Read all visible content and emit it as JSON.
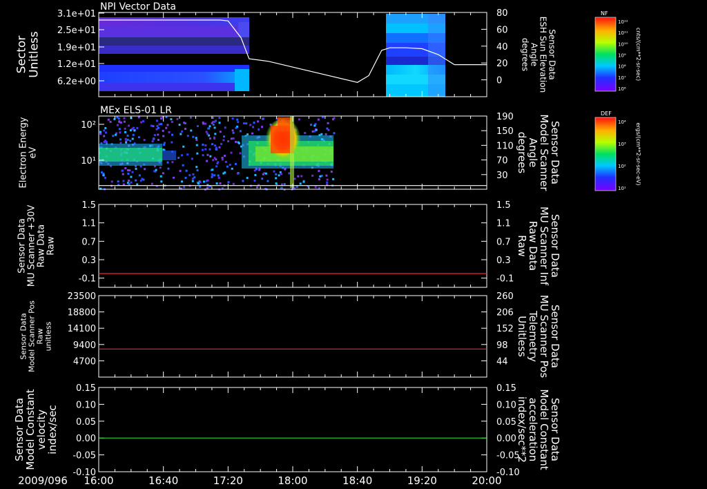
{
  "date_label": "2009/096",
  "time_ticks": [
    "16:00",
    "16:40",
    "17:20",
    "18:00",
    "18:40",
    "19:20",
    "20:00"
  ],
  "colorbars": [
    {
      "title": "NF",
      "unit": "cnts/(cm**2-sr-sec)",
      "tick_labels": [
        "10¹²",
        "10¹¹",
        "10¹⁰",
        "10⁹",
        "10⁸",
        "10⁷",
        "10⁶"
      ]
    },
    {
      "title": "DEF",
      "unit": "ergs/(cm**2-sr-sec-eV)",
      "tick_labels": [
        "10⁴",
        "10³",
        "10²",
        "10¹"
      ]
    }
  ],
  "colors": {
    "background": "#000000",
    "frame": "#ffffff",
    "red_trace": "#ff2020",
    "green_trace": "#22dd22"
  },
  "chart_data": [
    {
      "type": "heatmap",
      "title": "NPI Vector Data",
      "ylabel": [
        "Sector",
        "Unitless"
      ],
      "yticks": [
        "3.1e+01",
        "2.5e+01",
        "1.9e+01",
        "1.2e+01",
        "6.2e+00"
      ],
      "data_present_intervals": [
        [
          "16:00",
          "17:25"
        ],
        [
          "18:55",
          "19:30"
        ]
      ],
      "overlay": {
        "ylabel": [
          "Sensor Data",
          "ESH Sun Elevation",
          "Angle",
          "degrees"
        ],
        "yticks": [
          "80",
          "60",
          "40",
          "20",
          "0"
        ],
        "ylim": [
          -20,
          80
        ],
        "x": [
          "16:00",
          "17:15",
          "17:20",
          "17:28",
          "17:33",
          "17:45",
          "18:40",
          "18:47",
          "18:55",
          "19:00",
          "19:10",
          "19:20",
          "19:30",
          "19:40",
          "20:00"
        ],
        "y": [
          71,
          71,
          70,
          50,
          25,
          22,
          -3,
          5,
          35,
          38,
          38,
          37,
          30,
          18,
          18
        ]
      }
    },
    {
      "type": "heatmap",
      "title": "MEx ELS-01 LR",
      "ylabel": [
        "Electron Energy",
        "eV"
      ],
      "yticks": [
        "10²",
        "10¹"
      ],
      "data_present_interval": [
        "16:00",
        "18:40"
      ],
      "overlay": {
        "ylabel": [
          "Sensor Data",
          "Model Scanner",
          "Angle",
          "degrees"
        ],
        "yticks": [
          "190",
          "150",
          "110",
          "70",
          "30"
        ],
        "ylim": [
          -10,
          190
        ],
        "x": [
          "16:00",
          "20:00"
        ],
        "y": [
          0,
          0
        ]
      }
    },
    {
      "type": "line",
      "ylabel": [
        "Sensor Data",
        "MU Scanner +30V",
        "Raw Data",
        "Raw"
      ],
      "yticks": [
        "1.5",
        "1.1",
        "0.7",
        "0.3",
        "-0.1"
      ],
      "ylim": [
        -0.3,
        1.5
      ],
      "right_axis": {
        "ylabel": [
          "Sensor Data",
          "MU Scanner Inf",
          "Raw Data",
          "Raw"
        ],
        "yticks": [
          "1.5",
          "1.1",
          "0.7",
          "0.3",
          "-0.1"
        ],
        "ylim": [
          -0.3,
          1.5
        ]
      },
      "series": [
        {
          "x": [
            "16:00",
            "20:00"
          ],
          "y": [
            0,
            0
          ],
          "color": "#ff2020"
        }
      ]
    },
    {
      "type": "line",
      "ylabel": [
        "Sensor Data",
        "Model Scanner Pos",
        "Raw",
        "unitless"
      ],
      "yticks": [
        "23500",
        "18800",
        "14100",
        "9400",
        "4700"
      ],
      "ylim": [
        0,
        23500
      ],
      "right_axis": {
        "ylabel": [
          "Sensor Data",
          "MU Scanner Pos",
          "Telemetry",
          "Unitless"
        ],
        "yticks": [
          "260",
          "206",
          "152",
          "98",
          "44"
        ],
        "ylim": [
          -10,
          260
        ]
      },
      "series": [
        {
          "x": [
            "16:00",
            "20:00"
          ],
          "y": [
            8100,
            8100
          ],
          "color": "#ff2020"
        }
      ]
    },
    {
      "type": "line",
      "ylabel": [
        "Sensor Data",
        "Model Constant",
        "velocity",
        "index/sec"
      ],
      "yticks": [
        "0.15",
        "0.10",
        "0.05",
        "0.00",
        "-0.05",
        "-0.10"
      ],
      "ylim": [
        -0.1,
        0.15
      ],
      "right_axis": {
        "ylabel": [
          "Sensor Data",
          "Model Constant",
          "acceleration",
          "index/sec**2"
        ],
        "yticks": [
          "0.15",
          "0.10",
          "0.05",
          "0.00",
          "-0.05",
          "-0.10"
        ],
        "ylim": [
          -0.1,
          0.15
        ]
      },
      "series": [
        {
          "x": [
            "16:00",
            "20:00"
          ],
          "y": [
            0,
            0
          ],
          "color": "#22dd22"
        }
      ]
    }
  ]
}
